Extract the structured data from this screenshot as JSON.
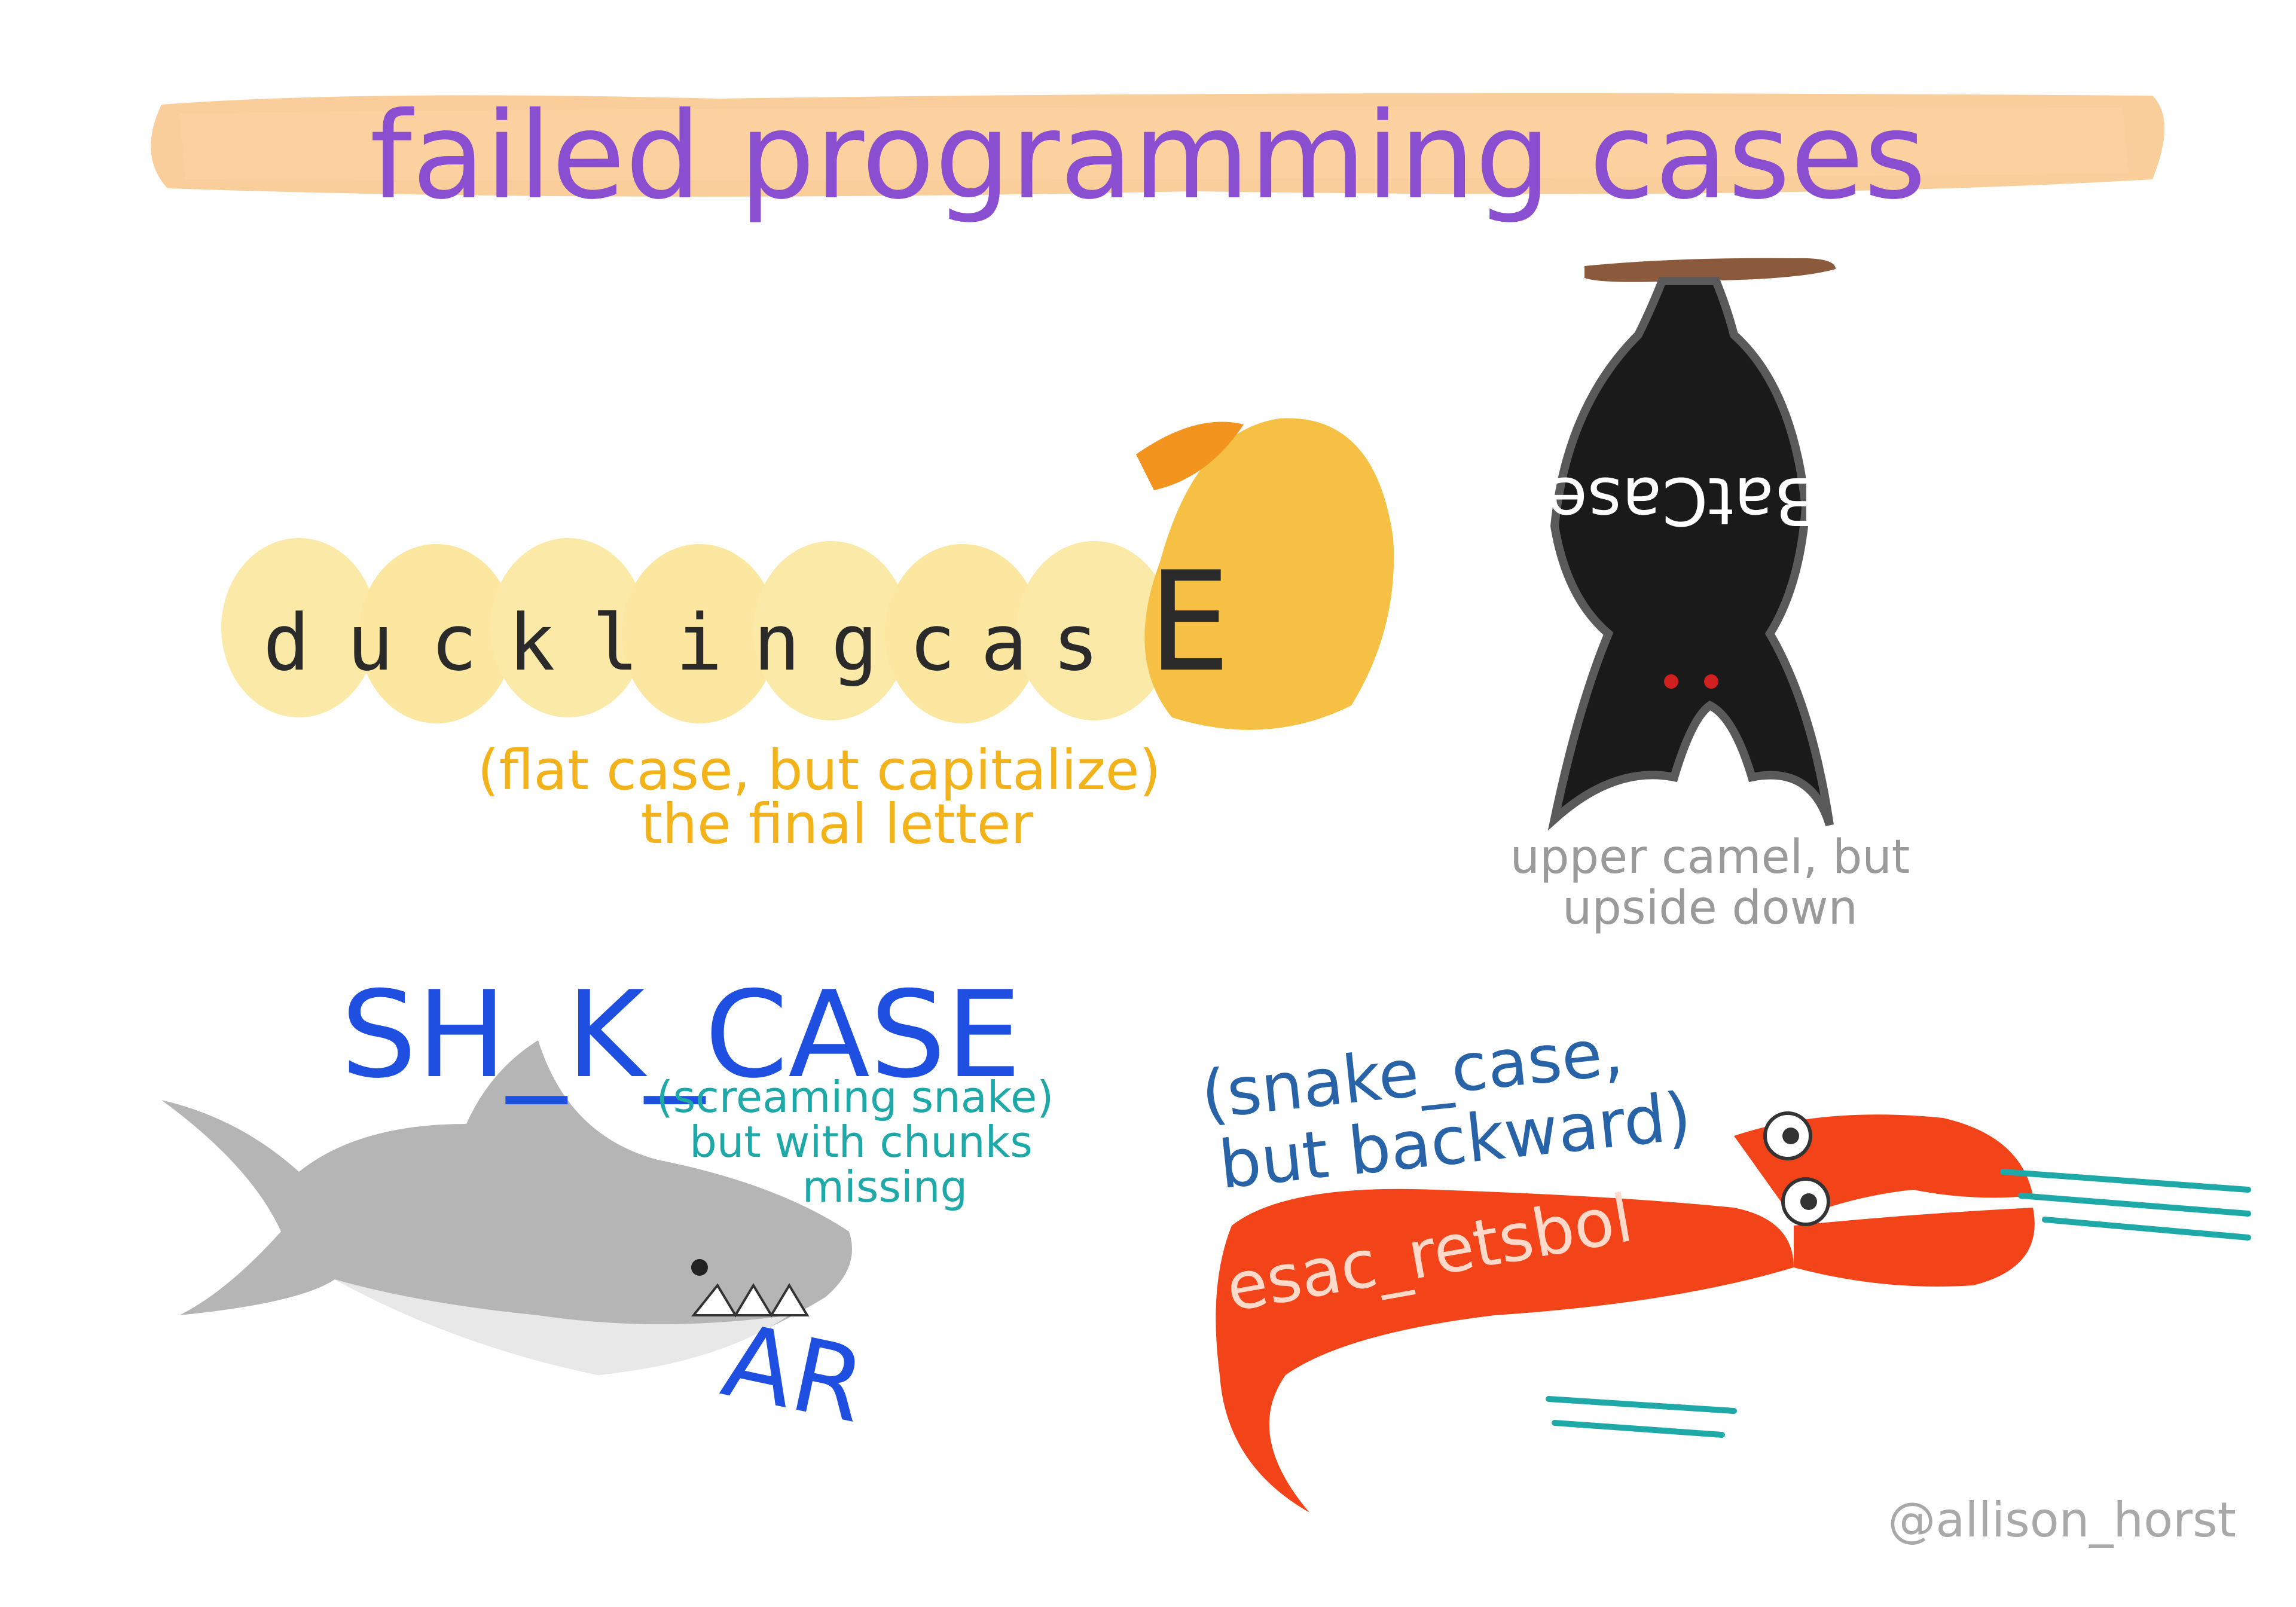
{
  "title": "failed programming cases",
  "colors": {
    "title": "#8a4fd0",
    "banner": "#f8c68a",
    "duck_label": "#f2b21a",
    "bat_label": "#9a9a9a",
    "shark_text": "#1f4fe0",
    "shark_label": "#1fa8a8",
    "lobster_label": "#2763a6",
    "lobster_body": "#f24418",
    "signature": "#a9a9a9"
  },
  "duckling": {
    "word": [
      "d",
      "u",
      "c",
      "k",
      "l",
      "i",
      "n",
      "g",
      "c",
      "a",
      "s",
      "E"
    ],
    "caption_line1": "(flat case, but capitalize)",
    "caption_line2": "the final letter"
  },
  "bat": {
    "word": "BatCase",
    "caption_line1": "upper camel, but",
    "caption_line2": "upside down"
  },
  "shark": {
    "heading": "SH_K_CASE",
    "bitten": "AR",
    "caption_line1": "(screaming snake)",
    "caption_line2": "but with chunks",
    "caption_line3": "missing"
  },
  "lobster": {
    "word": "esac_retsbol",
    "caption_line1": "(snake_case,",
    "caption_line2": "but backward)"
  },
  "signature": "@allison_horst"
}
